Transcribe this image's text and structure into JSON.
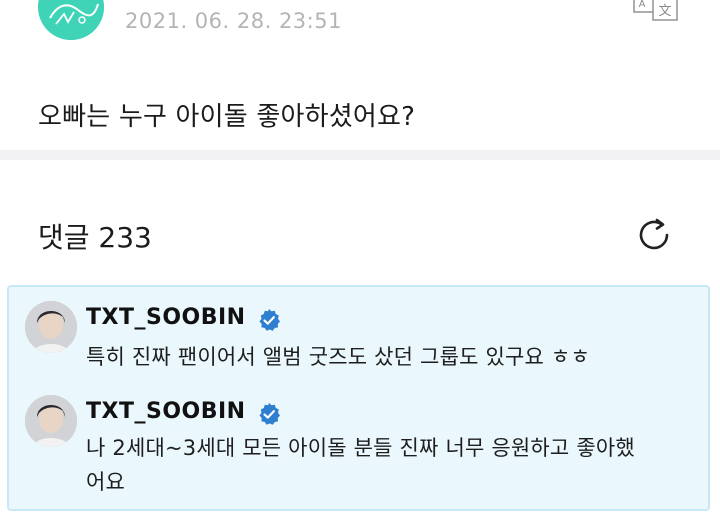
{
  "post": {
    "author_avatar": "weverse-artist-avatar",
    "timestamp": "2021. 06. 28. 23:51",
    "translate_icon": "translate-icon",
    "text": "오빠는 누구 아이돌 좋아하셨어요?"
  },
  "comments": {
    "title": "댓글 233",
    "refresh_icon": "refresh-icon"
  },
  "replies": [
    {
      "author": "TXT_SOOBIN",
      "badge": "verified-icon",
      "text": "특히 진짜 팬이어서 앨범 굿즈도 샀던 그룹도 있구요 ㅎㅎ"
    },
    {
      "author": "TXT_SOOBIN",
      "badge": "verified-icon",
      "text_line1": "나 2세대~3세대 모든 아이돌 분들 진짜 너무 응원하고 좋아했",
      "text_line2": "어요"
    }
  ],
  "colors": {
    "reply_bg": "#eaf7fc",
    "reply_border": "#c7e8f6",
    "verified": "#2f7fd1",
    "avatar_top": "#3fd3b8"
  }
}
